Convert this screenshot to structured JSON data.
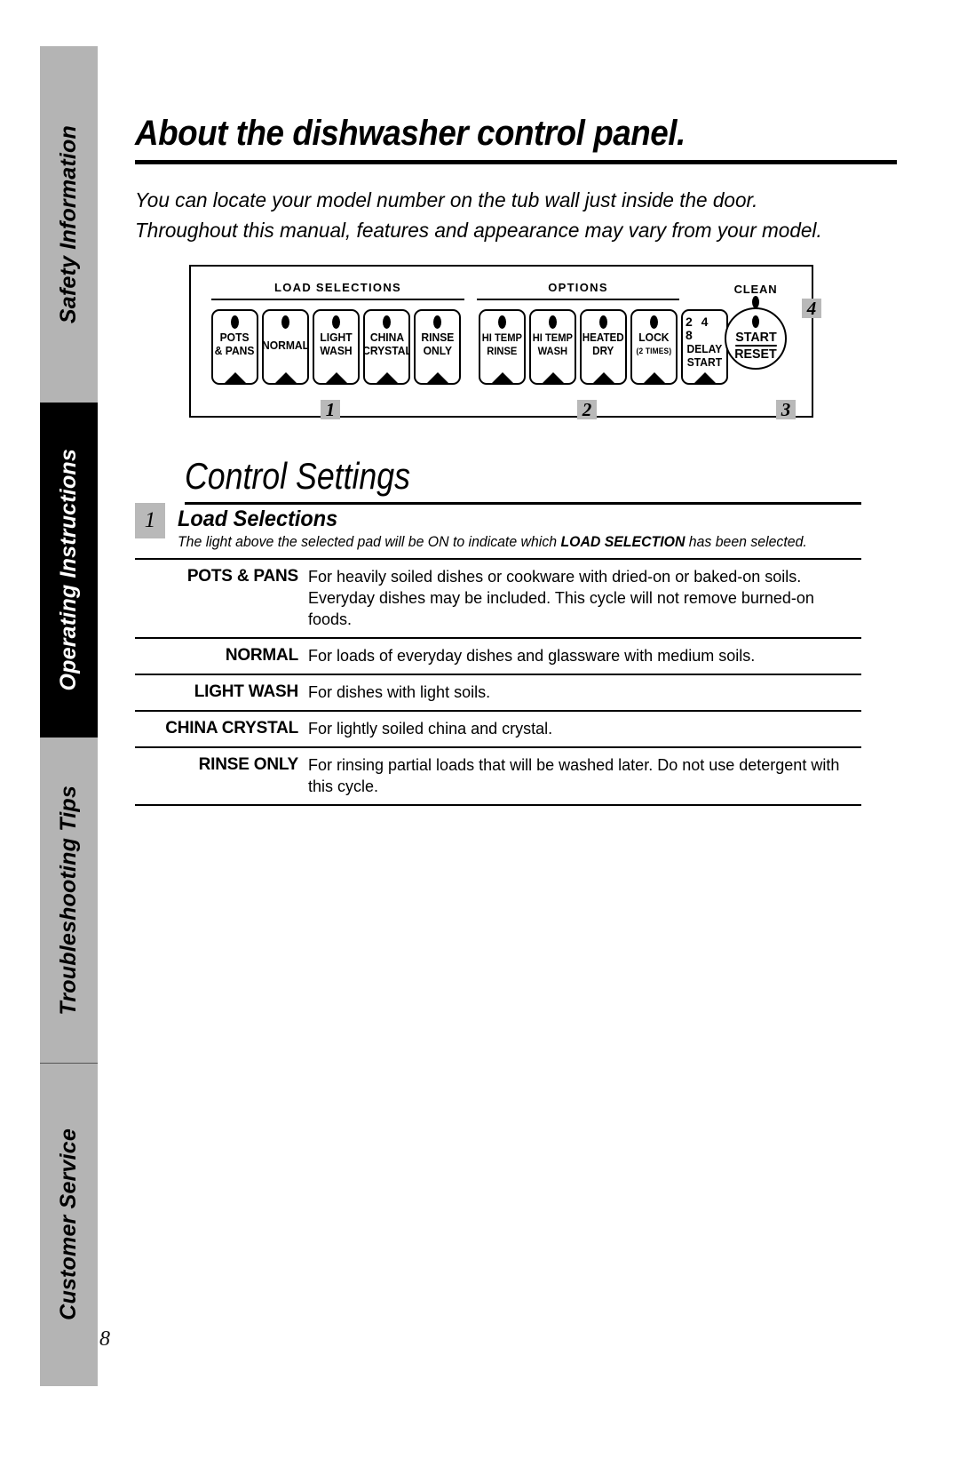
{
  "document": {
    "title": "About the dishwasher control panel.",
    "intro_line1": "You can locate your model number on the tub wall just inside the door.",
    "intro_line2": "Throughout this manual, features and appearance may vary from your model.",
    "page_number": "8"
  },
  "sidebar": {
    "tabs": [
      {
        "label": "Safety Information",
        "active": false
      },
      {
        "label": "Operating Instructions",
        "active": true
      },
      {
        "label": "Troubleshooting Tips",
        "active": false
      },
      {
        "label": "Customer Service",
        "active": false
      }
    ]
  },
  "control_panel": {
    "group_load": "LOAD SELECTIONS",
    "group_options": "OPTIONS",
    "clean_label": "CLEAN",
    "pads": [
      {
        "line1": "POTS",
        "line2": "& PANS"
      },
      {
        "line1": "NORMAL",
        "line2": ""
      },
      {
        "line1": "LIGHT",
        "line2": "WASH"
      },
      {
        "line1": "CHINA",
        "line2": "CRYSTAL"
      },
      {
        "line1": "RINSE",
        "line2": "ONLY"
      },
      {
        "line1": "HI TEMP",
        "line2": "RINSE"
      },
      {
        "line1": "HI TEMP",
        "line2": "WASH"
      },
      {
        "line1": "HEATED",
        "line2": "DRY"
      },
      {
        "line1": "LOCK",
        "line2": "(2 TIMES)"
      },
      {
        "digits": "2 4 8",
        "line1": "DELAY",
        "line2": "START"
      }
    ],
    "start_button": {
      "line1": "START",
      "line2": "RESET"
    },
    "callouts": {
      "one": "1",
      "two": "2",
      "three": "3",
      "four": "4"
    }
  },
  "control_settings": {
    "heading": "Control Settings",
    "section_number": "1",
    "section_title": "Load Selections",
    "section_sub_pre": "The light above the selected pad will be ON to indicate which ",
    "section_sub_bold": "LOAD SELECTION",
    "section_sub_post": " has been selected.",
    "entries": [
      {
        "term": "POTS & PANS",
        "desc": "For heavily soiled dishes or cookware with dried-on or baked-on soils. Everyday dishes may be included. This cycle will not remove burned-on foods."
      },
      {
        "term": "NORMAL",
        "desc": "For loads of everyday dishes and glassware with medium soils."
      },
      {
        "term": "LIGHT WASH",
        "desc": "For dishes with light soils."
      },
      {
        "term": "CHINA CRYSTAL",
        "desc": "For lightly soiled china and crystal."
      },
      {
        "term": "RINSE ONLY",
        "desc": "For rinsing partial loads that will be washed later. Do not use detergent with this cycle."
      }
    ]
  },
  "colors": {
    "tab_inactive": "#b4b4b4",
    "tab_active": "#000000",
    "callout_badge": "#b9b9b9",
    "text": "#000000"
  }
}
